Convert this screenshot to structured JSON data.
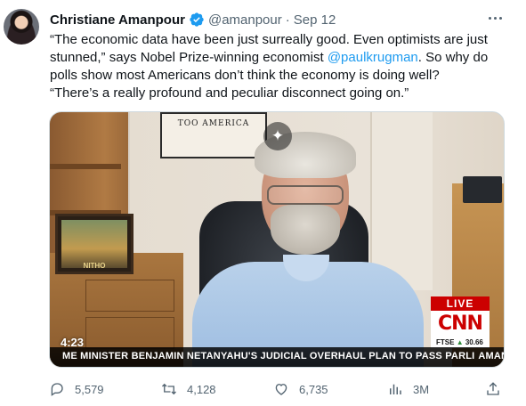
{
  "author": {
    "name": "Christiane Amanpour",
    "handle": "@amanpour",
    "separator": "·",
    "date": "Sep 12"
  },
  "tweet": {
    "line1": "“The economic data have been just surreally good. Even optimists are just",
    "line2_before": "stunned,” says Nobel Prize-winning economist ",
    "line2_link": "@paulkrugman",
    "line2_after": ". So why do",
    "line3": "polls show most Americans don’t think the economy is doing well?",
    "line4": "“There’s a really profound and peculiar disconnect going on.”"
  },
  "media": {
    "timestamp": "4:23",
    "ticker": "ME MINISTER BENJAMIN NETANYAHU'S JUDICIAL OVERHAUL PLAN TO PASS PARLI",
    "ticker_name": "AMANPOUR",
    "live_label": "LIVE",
    "network": "CNN",
    "market_label": "FTSE",
    "market_arrow": "▲",
    "market_value": "30.66",
    "poster_text": "TOO AMERICA",
    "photo_caption": "NITHO"
  },
  "actions": {
    "replies": "5,579",
    "reposts": "4,128",
    "likes": "6,735",
    "views": "3M"
  },
  "colors": {
    "link": "#1d9bf0",
    "verified": "#1d9bf0",
    "secondary_text": "#536471",
    "cnn_red": "#cc0000"
  },
  "icons": [
    "verified-badge-icon",
    "more-options-icon",
    "sparkle-icon",
    "reply-icon",
    "repost-icon",
    "like-icon",
    "views-icon",
    "share-icon"
  ]
}
